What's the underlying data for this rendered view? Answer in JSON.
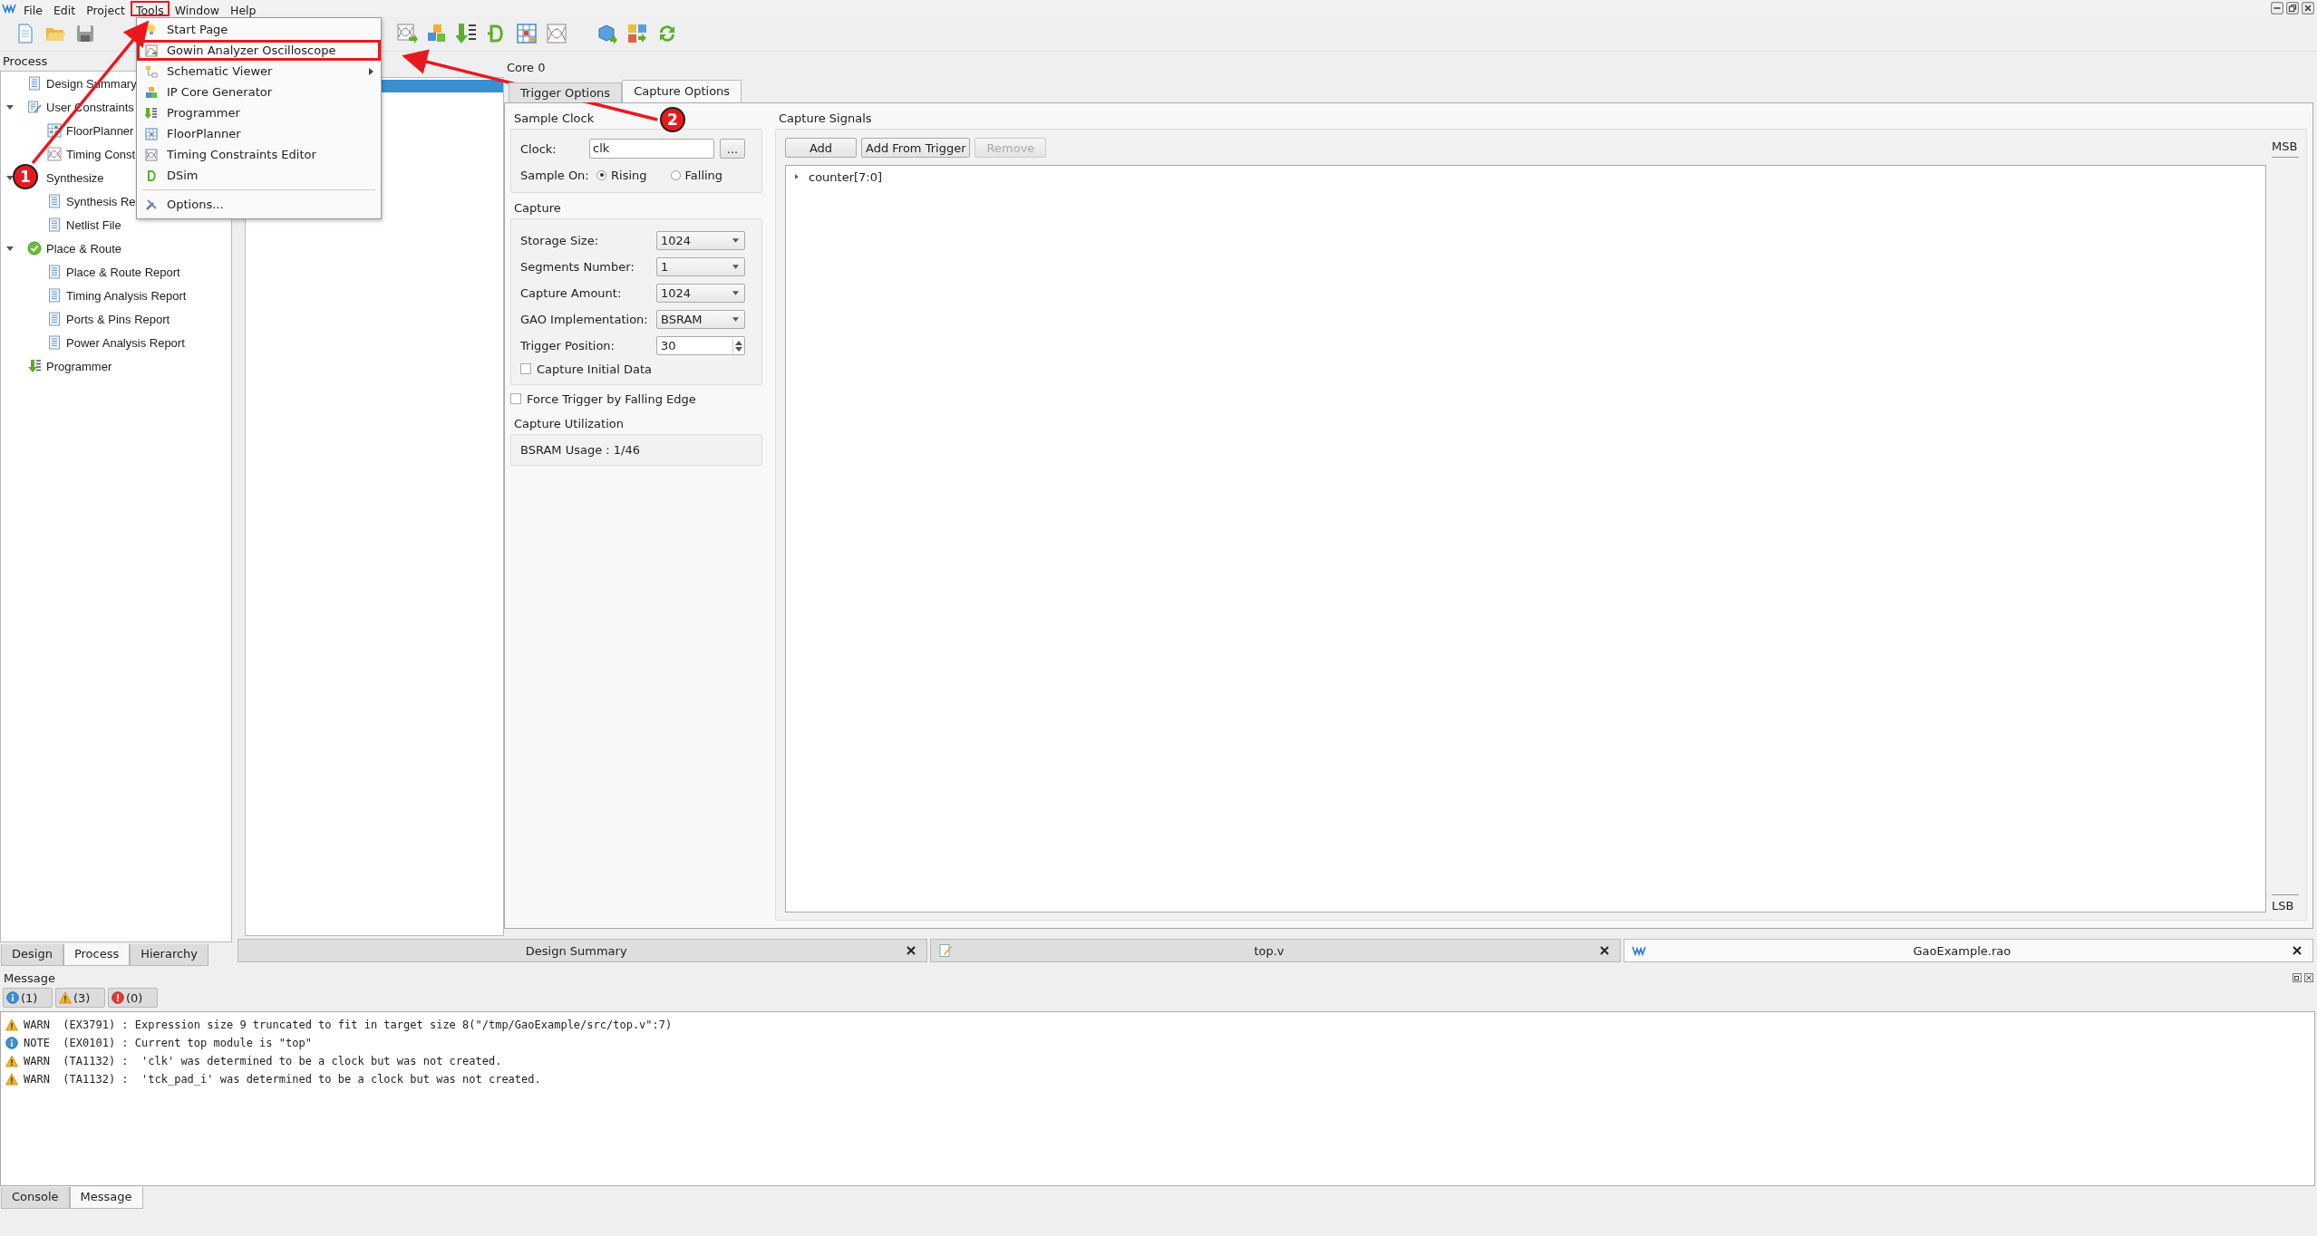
{
  "menubar": [
    {
      "label": "File",
      "marked": false
    },
    {
      "label": "Edit",
      "marked": false
    },
    {
      "label": "Project",
      "marked": false
    },
    {
      "label": "Tools",
      "marked": true
    },
    {
      "label": "Window",
      "marked": false
    },
    {
      "label": "Help",
      "marked": false
    }
  ],
  "tools_menu": {
    "items": [
      {
        "label": "Start Page",
        "marked": false,
        "submenu": false,
        "separator_before": false
      },
      {
        "label": "Gowin Analyzer Oscilloscope",
        "marked": true,
        "submenu": false,
        "separator_before": false
      },
      {
        "label": "Schematic Viewer",
        "marked": false,
        "submenu": true,
        "separator_before": false
      },
      {
        "label": "IP Core Generator",
        "marked": false,
        "submenu": false,
        "separator_before": false
      },
      {
        "label": "Programmer",
        "marked": false,
        "submenu": false,
        "separator_before": false
      },
      {
        "label": "FloorPlanner",
        "marked": false,
        "submenu": false,
        "separator_before": false
      },
      {
        "label": "Timing Constraints Editor",
        "marked": false,
        "submenu": false,
        "separator_before": false
      },
      {
        "label": "DSim",
        "marked": false,
        "submenu": false,
        "separator_before": false
      },
      {
        "label": "Options...",
        "marked": false,
        "submenu": false,
        "separator_before": true
      }
    ]
  },
  "callouts": [
    {
      "label": "1"
    },
    {
      "label": "2"
    }
  ],
  "process_panel": {
    "title": "Process",
    "tree": [
      {
        "label": "Design Summary",
        "kind": "summary"
      },
      {
        "label": "User Constraints",
        "kind": "constraints",
        "expanded": true,
        "children": [
          {
            "label": "FloorPlanner",
            "kind": "floorplanner"
          },
          {
            "label": "Timing Const",
            "kind": "timing"
          }
        ]
      },
      {
        "label": "Synthesize",
        "kind": "process",
        "expanded": true,
        "children": [
          {
            "label": "Synthesis Re",
            "kind": "report"
          },
          {
            "label": "Netlist File",
            "kind": "report"
          }
        ]
      },
      {
        "label": "Place & Route",
        "kind": "completed_process",
        "expanded": true,
        "children": [
          {
            "label": "Place & Route Report",
            "kind": "report"
          },
          {
            "label": "Timing Analysis Report",
            "kind": "report"
          },
          {
            "label": "Ports & Pins Report",
            "kind": "report"
          },
          {
            "label": "Power Analysis Report",
            "kind": "report"
          }
        ]
      },
      {
        "label": "Programmer",
        "kind": "programmer"
      }
    ],
    "tabs": [
      {
        "label": "Design",
        "selected": false
      },
      {
        "label": "Process",
        "selected": true
      },
      {
        "label": "Hierarchy",
        "selected": false
      }
    ]
  },
  "core_list": [
    {
      "selected": true
    }
  ],
  "core_label": "Core 0",
  "editor_tabs": [
    {
      "label": "Trigger Options",
      "selected": false
    },
    {
      "label": "Capture Options",
      "selected": true
    }
  ],
  "sample_clock": {
    "title": "Sample Clock",
    "clock_label": "Clock:",
    "clock_value": "clk",
    "browse_button": "...",
    "sample_on_label": "Sample On:",
    "options": [
      {
        "label": "Rising",
        "selected": true
      },
      {
        "label": "Falling",
        "selected": false
      }
    ]
  },
  "capture": {
    "title": "Capture",
    "fields": [
      {
        "label": "Storage Size:",
        "value": "1024",
        "kind": "dropdown"
      },
      {
        "label": "Segments Number:",
        "value": "1",
        "kind": "dropdown"
      },
      {
        "label": "Capture Amount:",
        "value": "1024",
        "kind": "dropdown"
      },
      {
        "label": "GAO Implementation:",
        "value": "BSRAM",
        "kind": "dropdown"
      },
      {
        "label": "Trigger Position:",
        "value": "30",
        "kind": "spinbox"
      }
    ],
    "initial_data": {
      "label": "Capture Initial Data",
      "checked": false
    }
  },
  "force_trigger": {
    "label": "Force Trigger by Falling Edge",
    "checked": false
  },
  "utilization": {
    "title": "Capture Utilization",
    "text": "BSRAM Usage :  1/46"
  },
  "capture_signals": {
    "title": "Capture Signals",
    "buttons": [
      {
        "label": "Add",
        "disabled": false
      },
      {
        "label": "Add From Trigger",
        "disabled": false
      },
      {
        "label": "Remove",
        "disabled": true
      }
    ],
    "signals": [
      {
        "label": "counter[7:0]",
        "expanded": false
      }
    ],
    "msb_label": "MSB",
    "lsb_label": "LSB"
  },
  "document_tabs": [
    {
      "label": "Design Summary",
      "selected": false,
      "kind": "summary"
    },
    {
      "label": "top.v",
      "selected": false,
      "kind": "source"
    },
    {
      "label": "GaoExample.rao",
      "selected": true,
      "kind": "gao"
    }
  ],
  "message_panel": {
    "title": "Message",
    "filters": [
      {
        "kind": "info",
        "label": "(1)"
      },
      {
        "kind": "warn",
        "label": "(3)"
      },
      {
        "kind": "error",
        "label": "(0)"
      }
    ],
    "messages": [
      {
        "kind": "warn",
        "text": "WARN  (EX3791) : Expression size 9 truncated to fit in target size 8(\"/tmp/GaoExample/src/top.v\":7)"
      },
      {
        "kind": "info",
        "text": "NOTE  (EX0101) : Current top module is \"top\""
      },
      {
        "kind": "warn",
        "text": "WARN  (TA1132) :  'clk' was determined to be a clock but was not created."
      },
      {
        "kind": "warn",
        "text": "WARN  (TA1132) :  'tck_pad_i' was determined to be a clock but was not created."
      }
    ]
  },
  "bottom_tabs": [
    {
      "label": "Console",
      "selected": false
    },
    {
      "label": "Message",
      "selected": true
    }
  ]
}
